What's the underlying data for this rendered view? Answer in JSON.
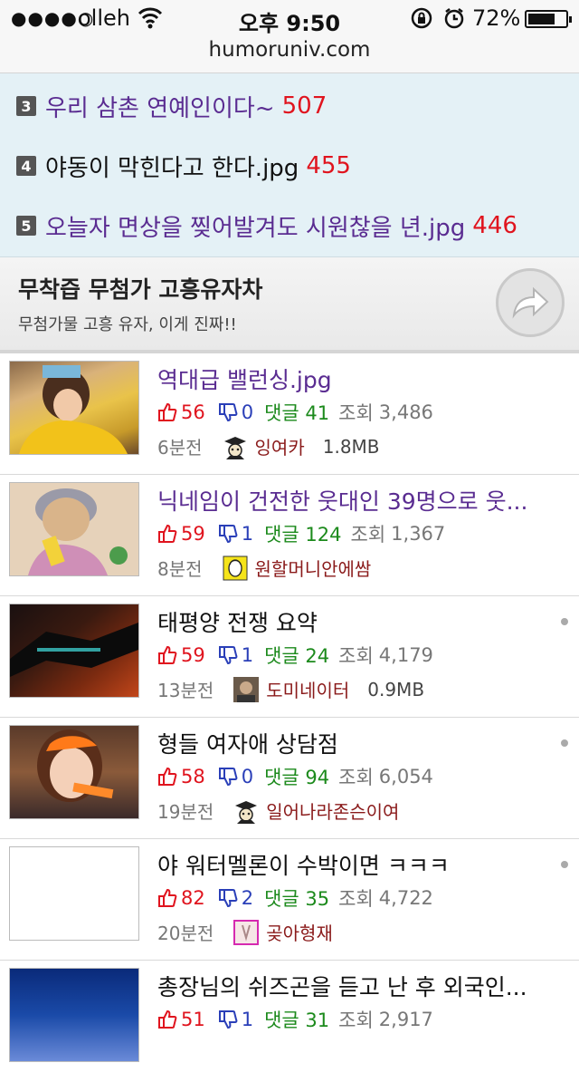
{
  "status_bar": {
    "signal": "●●●●○",
    "carrier": "olleh",
    "time": "오후 9:50",
    "battery_pct": "72%",
    "battery_level": 0.72
  },
  "url_bar": {
    "url": "humoruniv.com"
  },
  "ranking": [
    {
      "rank": "3",
      "title": "우리 삼촌 연예인이다~",
      "count": "507",
      "color": "purple"
    },
    {
      "rank": "4",
      "title": "야동이 막힌다고 한다.jpg",
      "count": "455",
      "color": "black"
    },
    {
      "rank": "5",
      "title": "오늘자 면상을 찢어발겨도 시원찮을 년.jpg",
      "count": "446",
      "color": "purple"
    }
  ],
  "banner": {
    "title": "무착즙 무첨가 고흥유자차",
    "subtitle": "무첨가물 고흥 유자, 이게 진짜!!",
    "icon": "arrow-forward-icon"
  },
  "posts": [
    {
      "title": "역대급 밸런싱.jpg",
      "color": "purple",
      "up": "56",
      "down": "0",
      "comments": "댓글 41",
      "views_label": "조회",
      "views": "3,486",
      "time": "6분전",
      "author": "잉여카",
      "author_icon": "grad-cap-icon",
      "size": "1.8MB",
      "dot": false,
      "thumb": "thumb-girl-yellow"
    },
    {
      "title": "닉네임이 건전한 웃대인 39명으로 웃...",
      "color": "purple",
      "up": "59",
      "down": "1",
      "comments": "댓글 124",
      "views_label": "조회",
      "views": "1,367",
      "time": "8분전",
      "author": "원할머니안에쌈",
      "author_icon": "avatar-sketch-icon",
      "size": "",
      "dot": false,
      "thumb": "thumb-grandma"
    },
    {
      "title": "태평양 전쟁 요약",
      "color": "black",
      "up": "59",
      "down": "1",
      "comments": "댓글 24",
      "views_label": "조회",
      "views": "4,179",
      "time": "13분전",
      "author": "도미네이터",
      "author_icon": "avatar-photo-icon",
      "size": "0.9MB",
      "dot": true,
      "thumb": "thumb-dark"
    },
    {
      "title": "형들 여자애 상담점",
      "color": "black",
      "up": "58",
      "down": "0",
      "comments": "댓글 94",
      "views_label": "조회",
      "views": "6,054",
      "time": "19분전",
      "author": "일어나라존슨이여",
      "author_icon": "grad-cap-icon",
      "size": "",
      "dot": true,
      "thumb": "thumb-girl-orange"
    },
    {
      "title": "야 워터멜론이 수박이면 ㅋㅋㅋ",
      "color": "black",
      "up": "82",
      "down": "2",
      "comments": "댓글 35",
      "views_label": "조회",
      "views": "4,722",
      "time": "20분전",
      "author": "곶아형재",
      "author_icon": "avatar-pink-icon",
      "size": "",
      "dot": true,
      "thumb": "thumb-empty"
    },
    {
      "title": "총장님의 쉬즈곤을 듣고 난 후 외국인...",
      "color": "black",
      "up": "51",
      "down": "1",
      "comments": "댓글 31",
      "views_label": "조회",
      "views": "2,917",
      "time": "",
      "author": "",
      "author_icon": "",
      "size": "",
      "dot": false,
      "thumb": "thumb-blue"
    }
  ]
}
